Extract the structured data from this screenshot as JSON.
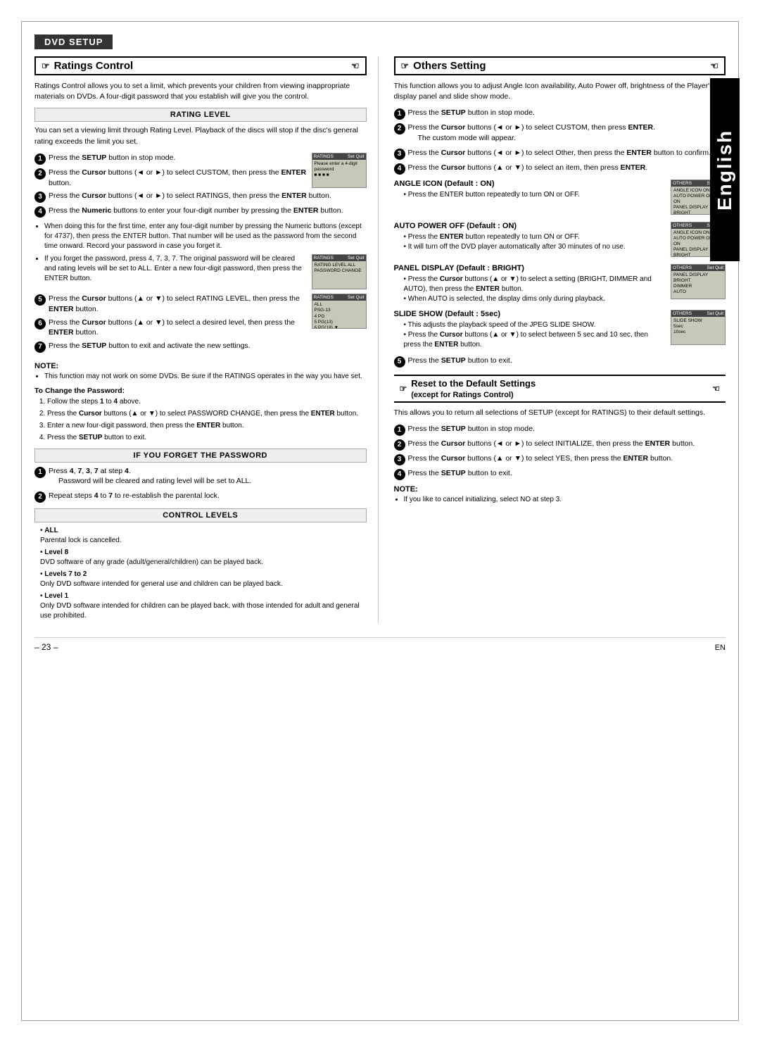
{
  "page": {
    "dvd_setup": "DVD SETUP",
    "language_label": "English",
    "page_number": "– 23 –",
    "en_label": "EN"
  },
  "ratings_control": {
    "title": "Ratings Control",
    "intro": "Ratings Control allows you to set a limit, which prevents your children from viewing inappropriate materials on DVDs. A four-digit password that you establish will give you the control.",
    "rating_level_header": "RATING LEVEL",
    "rating_level_intro": "You can set a viewing limit through Rating Level. Playback of the discs will stop if the disc's general rating exceeds the limit you set.",
    "steps": [
      "Press the SETUP button in stop mode.",
      "Press the Cursor buttons (◄ or ►) to select CUSTOM, then press the ENTER button.",
      "Press the Cursor buttons (◄ or ►) to select RATINGS, then press the ENTER button.",
      "Press the Numeric buttons to enter your four-digit number by pressing the ENTER button. That number will be used as the password from the second time onward. Record your password in case you forget it.",
      "Press the Cursor buttons (▲ or ▼) to select RATING LEVEL, then press the ENTER button.",
      "Press the Cursor buttons (▲ or ▼) to select a desired level, then press the ENTER button.",
      "Press the SETUP button to exit and activate the new settings."
    ],
    "step4_note1": "When doing this for the first time, enter any four-digit number by pressing the Numeric buttons (except for 4737), then press the ENTER button. That number will be used as the password from the second time onward. Record your password in case you forget it.",
    "step4_note2": "If you forget the password, press 4, 7, 3, 7. The original password will be cleared and rating levels will be set to ALL. Enter a new four-digit password, then press the ENTER button.",
    "note_title": "NOTE:",
    "note_text": "This function may not work on some DVDs. Be sure if the RATINGS operates in the way you have set.",
    "to_change_title": "To Change the Password:",
    "to_change_steps": [
      "Follow the steps 1 to 4 above.",
      "Press the Cursor buttons (▲ or ▼) to select PASSWORD CHANGE, then press the ENTER button.",
      "Enter a new four-digit password, then press the ENTER button.",
      "Press the SETUP button to exit."
    ],
    "if_forget_header": "IF YOU FORGET THE PASSWORD",
    "forget_step1": "Press 4, 7, 3, 7 at step 4.",
    "forget_step1_note": "Password will be cleared and rating level will be set to ALL.",
    "forget_step2": "Repeat steps 4 to 7 to re-establish the parental lock.",
    "control_levels_header": "CONTROL LEVELS",
    "levels": [
      {
        "label": "ALL",
        "desc": "Parental lock is cancelled."
      },
      {
        "label": "Level 8",
        "desc": "DVD software of any grade (adult/general/children) can be played back."
      },
      {
        "label": "Levels 7 to 2",
        "desc": "Only DVD software intended for general use and children can be played back."
      },
      {
        "label": "Level 1",
        "desc": "Only DVD software intended for children can be played back, with those intended for adult and general use prohibited."
      }
    ]
  },
  "others_setting": {
    "title": "Others Setting",
    "intro": "This function allows you to adjust Angle Icon availability, Auto Power off, brightness of the Player's display panel and slide show mode.",
    "steps_intro": [
      "Press the SETUP button in stop mode.",
      "Press the Cursor buttons (◄ or ►) to select CUSTOM, then press ENTER.",
      "Press the Cursor buttons (◄ or ►) to select Other, then press the ENTER button to confirm.",
      "Press the Cursor buttons (▲ or ▼) to select an item, then press ENTER."
    ],
    "custom_mode_note": "The custom mode will appear.",
    "angle_icon_header": "ANGLE ICON (Default : ON)",
    "angle_icon_desc": "Press the ENTER button repeatedly to turn ON or OFF.",
    "auto_power_header": "AUTO POWER OFF (Default : ON)",
    "auto_power_bullets": [
      "Press the ENTER button repeatedly to turn ON or OFF.",
      "It will turn off the DVD player automatically after 30 minutes of no use."
    ],
    "panel_display_header": "PANEL DISPLAY (Default : BRIGHT)",
    "panel_display_bullets": [
      "Press the Cursor buttons (▲ or ▼) to select a setting (BRIGHT, DIMMER and AUTO), then press the ENTER button.",
      "When AUTO is selected, the display dims only during playback."
    ],
    "slide_show_header": "SLIDE SHOW (Default : 5sec)",
    "slide_show_bullets": [
      "This adjusts the playback speed of the JPEG SLIDE SHOW.",
      "Press the Cursor buttons (▲ or ▼) to select between 5 sec and 10 sec, then press the ENTER button."
    ],
    "step5": "Press the SETUP button to exit."
  },
  "reset_section": {
    "title": "Reset to the Default Settings",
    "subtitle": "(except for Ratings Control)",
    "intro": "This allows you to return all selections of SETUP (except for RATINGS) to their default settings.",
    "steps": [
      "Press the SETUP button in stop mode.",
      "Press the Cursor buttons (◄ or ►) to select INITIALIZE, then press the ENTER button.",
      "Press the Cursor buttons (▲ or ▼) to select YES, then press the ENTER button.",
      "Press the SETUP button to exit."
    ],
    "note_title": "NOTE:",
    "note_text": "If you like to cancel initializing, select NO at step 3."
  }
}
